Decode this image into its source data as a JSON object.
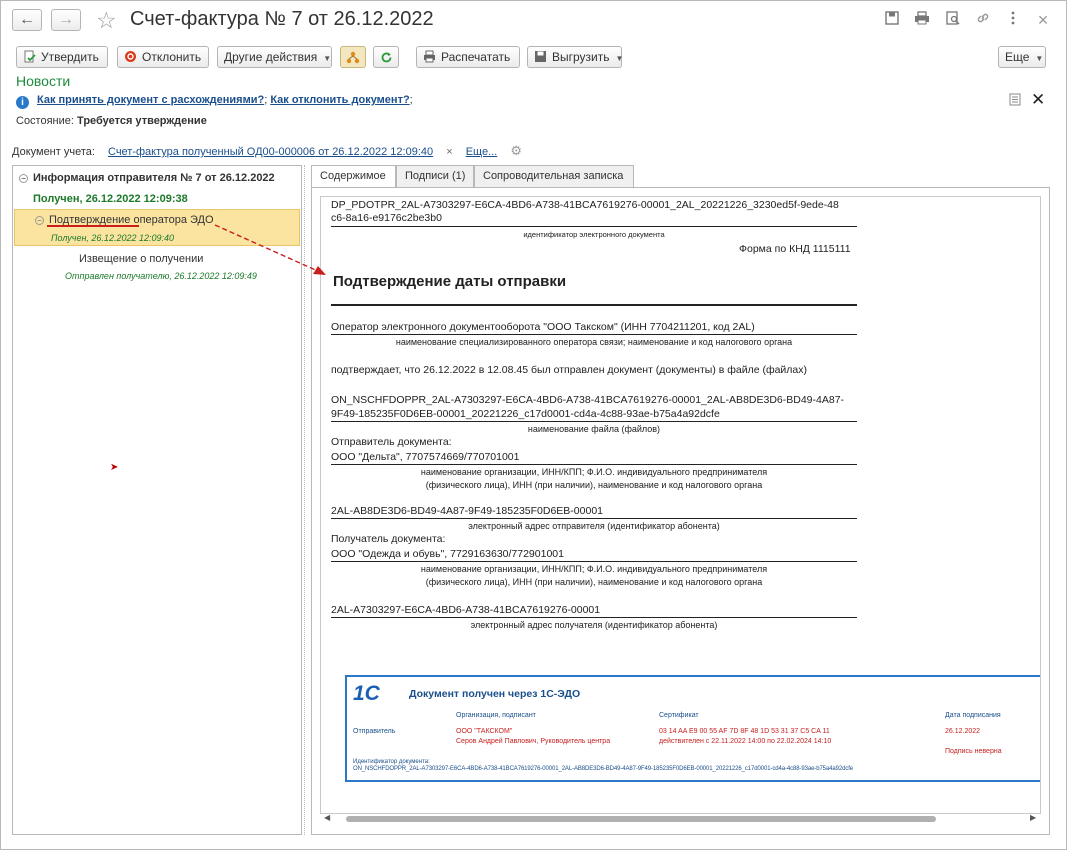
{
  "header": {
    "title": "Счет-фактура № 7 от 26.12.2022",
    "back_icon": "←",
    "forward_icon": "→",
    "star_icon": "☆",
    "close_icon": "×"
  },
  "toolbar": {
    "approve": "Утвердить",
    "reject": "Отклонить",
    "other_actions": "Другие действия",
    "print": "Распечатать",
    "export": "Выгрузить",
    "more": "Еще"
  },
  "news": "Новости",
  "info": {
    "link1": "Как принять документ с расхождениями?",
    "sep": ";",
    "link2": "Как отклонить документ?",
    "end": ";"
  },
  "state": {
    "label": "Состояние:",
    "value": "Требуется утверждение"
  },
  "accounting_doc": {
    "label": "Документ учета:",
    "link": "Счет-фактура полученный ОД00-000006 от 26.12.2022 12:09:40",
    "clear": "×",
    "more": "Еще..."
  },
  "tree": {
    "header": "Информация отправителя № 7 от 26.12.2022",
    "received": "Получен, 26.12.2022 12:09:38",
    "selected_item": "Подтверждение оператора ЭДО",
    "selected_status": "Получен, 26.12.2022 12:09:40",
    "notice_item": "Извещение о получении",
    "notice_status": "Отправлен получателю, 26.12.2022 12:09:49"
  },
  "tabs": [
    {
      "label": "Содержимое"
    },
    {
      "label": "Подписи (1)"
    },
    {
      "label": "Сопроводительная записка"
    }
  ],
  "document": {
    "file_id_line1": "DP_PDOTPR_2AL-A7303297-E6CA-4BD6-A738-41BCA7619276-00001_2AL_20221226_3230ed5f-9ede-48",
    "file_id_line2": "c6-8a16-e9176c2be3b0",
    "file_id_caption": "идентификатор электронного документа",
    "form": "Форма по КНД 1115111",
    "heading": "Подтверждение даты отправки",
    "operator": "Оператор электронного документооборота \"ООО Такском\" (ИНН 7704211201, код 2AL)",
    "operator_caption": "наименование специализированного оператора связи; наименование и код налогового органа",
    "confirms": "подтверждает, что 26.12.2022 в 12.08.45 был отправлен документ (документы) в файле (файлах)",
    "filename_line1": "ON_NSCHFDOPPR_2AL-A7303297-E6CA-4BD6-A738-41BCA7619276-00001_2AL-AB8DE3D6-BD49-4A87-",
    "filename_line2": "9F49-185235F0D6EB-00001_20221226_c17d0001-cd4a-4c88-93ae-b75a4a92dcfe",
    "filename_caption": "наименование файла (файлов)",
    "sender_label": "Отправитель документа:",
    "sender": "ООО \"Дельта\", 7707574669/770701001",
    "org_caption1": "наименование организации, ИНН/КПП; Ф.И.О. индивидуального предпринимателя",
    "org_caption2": "(физического лица), ИНН (при наличии), наименование и код налогового органа",
    "sender_addr": "2AL-AB8DE3D6-BD49-4A87-9F49-185235F0D6EB-00001",
    "sender_addr_caption": "электронный адрес отправителя (идентификатор абонента)",
    "recipient_label": "Получатель документа:",
    "recipient": "ООО \"Одежда и обувь\", 7729163630/772901001",
    "recipient_addr": "2AL-A7303297-E6CA-4BD6-A738-41BCA7619276-00001",
    "recipient_addr_caption": "электронный адрес получателя (идентификатор абонента)"
  },
  "stamp": {
    "logo": "1С",
    "title": "Документ получен через 1С-ЭДО",
    "col_org": "Организация, подписант",
    "col_cert": "Сертификат",
    "col_date": "Дата подписания",
    "row_label": "Отправитель",
    "org": "ООО \"ТАКСКОМ\"",
    "signer": "Серов Андрей Павлович, Руководитель центра",
    "cert": "03 14 AA E9 00 55 AF 7D 8F 48 1D 53 31 37 C5 CA 11",
    "valid": "действителен с 22.11.2022 14:00 по 22.02.2024 14:10",
    "date": "26.12.2022",
    "check": "Подпись неверна",
    "doc_id_label": "Идентификатор документа:",
    "doc_id": "ON_NSCHFDOPPR_2AL-A7303297-E6CA-4BD6-A738-41BCA7619276-00001_2AL-AB8DE3D6-BD49-4A87-9F49-185235F0D6EB-00001_20221226_c17d0001-cd4a-4c88-93ae-b75a4a92dcfe"
  }
}
